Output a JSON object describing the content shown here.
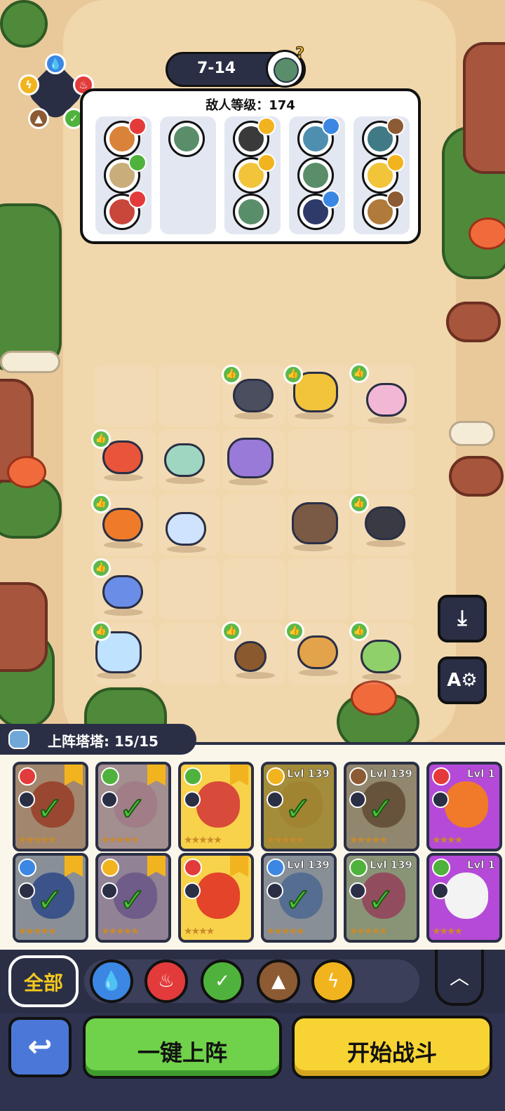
{
  "stage": {
    "label": "7-14",
    "hint_symbol": "?"
  },
  "enemy_panel": {
    "level_text": "敌人等级：174"
  },
  "roster": {
    "count_text": "上阵塔塔: 15/15"
  },
  "cards": [
    {
      "level": "",
      "element": "fire",
      "stars": "★★★★★",
      "deployed": true
    },
    {
      "level": "",
      "element": "leaf",
      "stars": "★★★★★",
      "deployed": true
    },
    {
      "level": "",
      "element": "leaf",
      "stars": "★★★★★",
      "deployed": false
    },
    {
      "level": "Lvl 139",
      "element": "bolt",
      "stars": "★★★★★",
      "deployed": true
    },
    {
      "level": "Lvl 139",
      "element": "earth",
      "stars": "★★★★★",
      "deployed": true
    },
    {
      "level": "Lvl 1",
      "element": "fire",
      "stars": "★★★★",
      "deployed": false
    },
    {
      "level": "",
      "element": "water",
      "stars": "★★★★★",
      "deployed": true
    },
    {
      "level": "",
      "element": "bolt",
      "stars": "★★★★★",
      "deployed": true
    },
    {
      "level": "",
      "element": "fire",
      "stars": "★★★★",
      "deployed": false
    },
    {
      "level": "Lvl 139",
      "element": "water",
      "stars": "★★★★★",
      "deployed": true
    },
    {
      "level": "Lvl 139",
      "element": "leaf",
      "stars": "★★★★★",
      "deployed": true
    },
    {
      "level": "Lvl 1",
      "element": "leaf",
      "stars": "★★★★",
      "deployed": false
    }
  ],
  "filters": {
    "all_label": "全部"
  },
  "buttons": {
    "back_symbol": "↩",
    "auto_deploy": "一键上阵",
    "start_battle": "开始战斗"
  },
  "colors": {
    "water": "#3b87e3",
    "fire": "#e33b3b",
    "leaf": "#4fb23c",
    "earth": "#8c5a33",
    "bolt": "#f2b41e"
  }
}
